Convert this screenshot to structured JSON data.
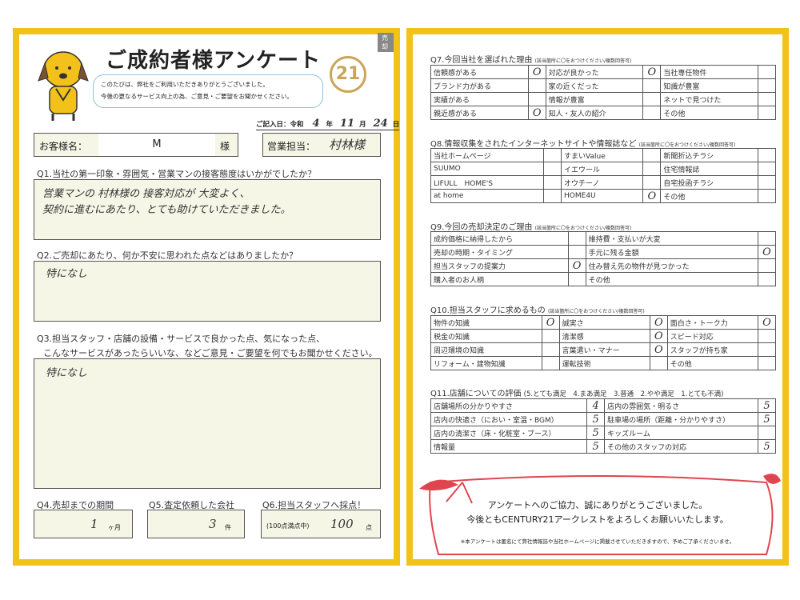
{
  "sold_tag": "売却",
  "header": {
    "title": "ご成約者様アンケート",
    "bubble_line1": "このたびは、弊社をご利用いただきありがとうございました。",
    "bubble_line2": "今後の更なるサービス向上の為、ご意見・ご要望をお聞かせください。",
    "logo_text": "21",
    "date_label": "ご記入日：令和",
    "date_year": "4",
    "date_year_unit": "年",
    "date_month": "11",
    "date_month_unit": "月",
    "date_day": "24",
    "date_day_unit": "日"
  },
  "customer": {
    "label": "お客様名：",
    "name": "M",
    "honorific": "様",
    "staff_label": "営業担当：",
    "staff_name": "村林様"
  },
  "q1": {
    "question": "Q1.当社の第一印象・雰囲気・営業マンの接客態度はいかがでしたか？",
    "answer_line1": "営業マンの 村林様の 接客対応が 大変よく、",
    "answer_line2": "契約に進むにあたり、とても助けていただきました。"
  },
  "q2": {
    "question": "Q2.ご売却にあたり、何か不安に思われた点などはありましたか？",
    "answer": "特になし"
  },
  "q3": {
    "question_line1": "Q3.担当スタッフ・店舗の設備・サービスで良かった点、気になった点、",
    "question_line2": "こんなサービスがあったらいいな、などご意見・ご要望を何でもお聞かせください。",
    "answer": "特になし"
  },
  "q4": {
    "question": "Q4.売却までの期間",
    "answer": "1",
    "unit": "ヶ月"
  },
  "q5": {
    "question": "Q5.査定依頼した会社",
    "answer": "3",
    "unit": "件"
  },
  "q6": {
    "question": "Q6.担当スタッフへ採点！",
    "prefix": "(100点満点中)",
    "answer": "100",
    "unit": "点"
  },
  "q7": {
    "title": "Q7.今回当社を選ばれた理由",
    "note": "(該当箇所に〇をおつけください/複数回答可)",
    "rows": [
      [
        {
          "t": "信頼感がある",
          "m": "O"
        },
        {
          "t": "対応が良かった",
          "m": "O"
        },
        {
          "t": "当社専任物件",
          "m": ""
        }
      ],
      [
        {
          "t": "ブランド力がある",
          "m": ""
        },
        {
          "t": "家の近くだった",
          "m": ""
        },
        {
          "t": "知識が豊富",
          "m": ""
        }
      ],
      [
        {
          "t": "実績がある",
          "m": ""
        },
        {
          "t": "情報が豊富",
          "m": ""
        },
        {
          "t": "ネットで見つけた",
          "m": ""
        }
      ],
      [
        {
          "t": "親近感がある",
          "m": "O"
        },
        {
          "t": "知人・友人の紹介",
          "m": ""
        },
        {
          "t": "その他",
          "m": ""
        }
      ]
    ]
  },
  "q8": {
    "title": "Q8.情報収集をされたインターネットサイトや情報誌など",
    "note": "(該当箇所に〇をおつけください/複数回答可)",
    "rows": [
      [
        {
          "t": "当社ホームページ",
          "m": ""
        },
        {
          "t": "すまいValue",
          "m": ""
        },
        {
          "t": "新聞折込チラシ",
          "m": ""
        }
      ],
      [
        {
          "t": "SUUMO",
          "m": ""
        },
        {
          "t": "イエウール",
          "m": ""
        },
        {
          "t": "住宅情報誌",
          "m": ""
        }
      ],
      [
        {
          "t": "LIFULL　HOME'S",
          "m": ""
        },
        {
          "t": "オウチーノ",
          "m": ""
        },
        {
          "t": "自宅投函チラシ",
          "m": ""
        }
      ],
      [
        {
          "t": "at home",
          "m": ""
        },
        {
          "t": "HOME4U",
          "m": "O"
        },
        {
          "t": "その他",
          "m": ""
        }
      ]
    ]
  },
  "q9": {
    "title": "Q9.今回の売却決定のご理由",
    "note": "(該当箇所に〇をおつけください/複数回答可)",
    "rows": [
      [
        {
          "t": "成約価格に納得したから",
          "m": ""
        },
        {
          "t": "維持費・支払いが大変",
          "m": ""
        }
      ],
      [
        {
          "t": "売却の時期・タイミング",
          "m": ""
        },
        {
          "t": "手元に残る金額",
          "m": "O"
        }
      ],
      [
        {
          "t": "担当スタッフの提案力",
          "m": "O"
        },
        {
          "t": "住み替え先の物件が見つかった",
          "m": ""
        }
      ],
      [
        {
          "t": "購入者のお人柄",
          "m": ""
        },
        {
          "t": "その他",
          "m": ""
        }
      ]
    ]
  },
  "q10": {
    "title": "Q10.担当スタッフに求めるもの",
    "note": "(該当箇所に〇をおつけください/複数回答可)",
    "rows": [
      [
        {
          "t": "物件の知識",
          "m": "O"
        },
        {
          "t": "誠実さ",
          "m": "O"
        },
        {
          "t": "面白さ・トーク力",
          "m": "O"
        }
      ],
      [
        {
          "t": "税金の知識",
          "m": ""
        },
        {
          "t": "清潔感",
          "m": "O"
        },
        {
          "t": "スピード対応",
          "m": ""
        }
      ],
      [
        {
          "t": "周辺環境の知識",
          "m": ""
        },
        {
          "t": "言葉遣い・マナー",
          "m": "O"
        },
        {
          "t": "スタッフが持ち家",
          "m": ""
        }
      ],
      [
        {
          "t": "リフォーム・建物知識",
          "m": ""
        },
        {
          "t": "運転技術",
          "m": ""
        },
        {
          "t": "その他",
          "m": ""
        }
      ]
    ]
  },
  "q11": {
    "title": "Q11.店舗についての評価",
    "scale": "(5.とても満足　4.まあ満足　3.普通　2.やや満足　1.とても不満)",
    "rows": [
      [
        {
          "t": "店舗場所の分かりやすさ",
          "m": "4"
        },
        {
          "t": "店内の雰囲気・明るさ",
          "m": "5"
        }
      ],
      [
        {
          "t": "店内の快適さ（におい・室温・BGM）",
          "m": "5"
        },
        {
          "t": "駐車場の場所（距離・分かりやすさ）",
          "m": "5"
        }
      ],
      [
        {
          "t": "店内の清潔さ（床・化粧室・ブース）",
          "m": "5"
        },
        {
          "t": "キッズルーム",
          "m": ""
        }
      ],
      [
        {
          "t": "情報量",
          "m": "5"
        },
        {
          "t": "その他のスタッフの対応",
          "m": "5"
        }
      ]
    ]
  },
  "thanks": {
    "line1": "アンケートへのご協力、誠にありがとうございました。",
    "line2": "今後ともCENTURY21アークレストをよろしくお願いいたします。",
    "note": "※本アンケートは匿名にて弊社情報誌や当社ホームページに掲載させていただきますので、予めご了承くださいませ。"
  },
  "colors": {
    "frame": "#f2c21a",
    "field_bg": "#f5f6e6",
    "ribbon": "#e0454f",
    "logo": "#c9a659"
  }
}
